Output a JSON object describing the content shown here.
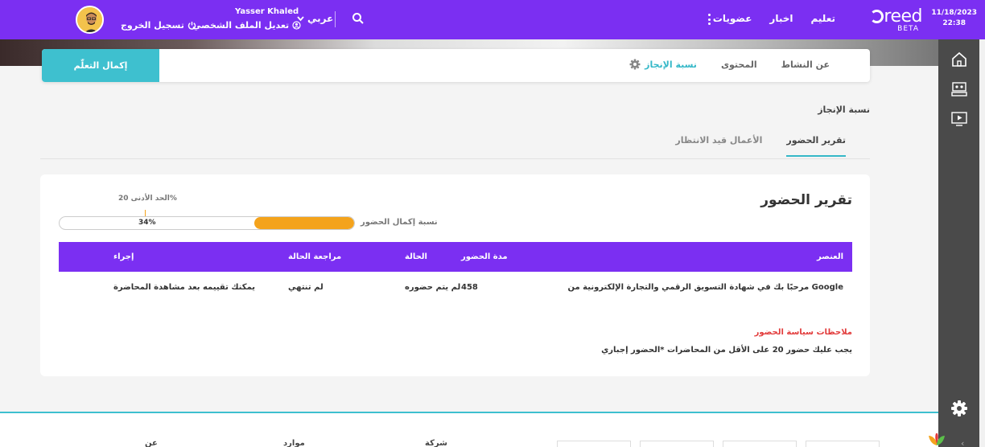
{
  "topbar": {
    "date": "11/18/2023",
    "time": "22:38",
    "logo_text": "reed",
    "logo_badge": "BETA",
    "nav": [
      {
        "label": "تعليم"
      },
      {
        "label": "اخبار"
      },
      {
        "label": "عضويات"
      }
    ],
    "language": "عربي",
    "user_name": "Yasser Khaled",
    "edit_profile": "تعديل الملف الشخصي",
    "logout": "تسجيل الخروج"
  },
  "sidebar": {
    "icons": [
      "home-icon",
      "classroom-icon",
      "video-icon",
      "settings-icon"
    ]
  },
  "tabs": {
    "complete_button": "إكمال التعلّم",
    "items": [
      {
        "label": "عن النشاط"
      },
      {
        "label": "المحتوى"
      },
      {
        "label": "نسبة الإنجاز"
      }
    ],
    "active_index": 2
  },
  "section": {
    "label": "نسبة الإنجاز",
    "subtabs": [
      {
        "label": "تقرير الحضور"
      },
      {
        "label": "الأعمال قيد الانتظار"
      }
    ]
  },
  "report": {
    "title": "تقرير الحضور",
    "min_label": "الحد الأدنى 20%",
    "min_percent": 20,
    "progress_label": "نسبة إكمال الحضور",
    "progress_value": "34%",
    "progress_percent": 34,
    "columns": {
      "item": "العنصر",
      "duration": "مدة الحضور",
      "status": "الحالة",
      "review": "مراجعة الحالة",
      "action": "إجراء"
    },
    "rows": [
      {
        "item": "مرحبًا بك في شهادة التسويق الرقمي والتجارة الإلكترونية من Google",
        "duration": "458",
        "status": "لم يتم حضوره",
        "review": "لم تنتهي",
        "action": "يمكنك تقييمه بعد مشاهدة المحاضرة"
      }
    ],
    "notes_title": "ملاحظات سياسة الحضور",
    "notes_text": "يجب عليك حضور 20 على الأقل من المحاضرات *الحضور إجباري"
  },
  "footer": {
    "columns": [
      "عن",
      "موارد",
      "شركة"
    ]
  },
  "colors": {
    "primary": "#7b2ff2",
    "accent": "#3ec0cf",
    "progress": "#f4a31c",
    "notes": "#e23b3b"
  }
}
